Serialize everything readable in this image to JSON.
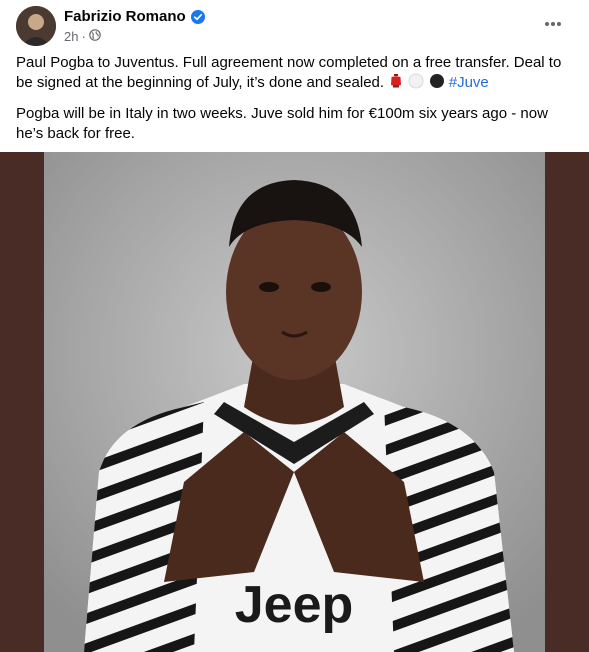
{
  "post": {
    "author": "Fabrizio Romano",
    "time": "2h",
    "audience_icon": "globe-icon",
    "verified_icon": "verified-badge-icon",
    "more_icon": "more-options-icon",
    "paragraph1_text": "Paul Pogba to Juventus. Full agreement now completed on a free transfer. Deal to be signed at the beginning of July, it’s done and sealed. ",
    "hashtag": "#Juve",
    "paragraph2": "Pogba will be in Italy in two weeks. Juve sold him for €100m six years ago - now he’s back for free."
  },
  "colors": {
    "hashtag": "#216fdb",
    "verified": "#1877f2",
    "media_background": "#4a2c27",
    "jersey_stripes": "#111111"
  },
  "emojis": [
    "red-lantern-icon",
    "white-circle-icon",
    "black-circle-icon"
  ],
  "media": {
    "jersey_text": "Jeep"
  }
}
